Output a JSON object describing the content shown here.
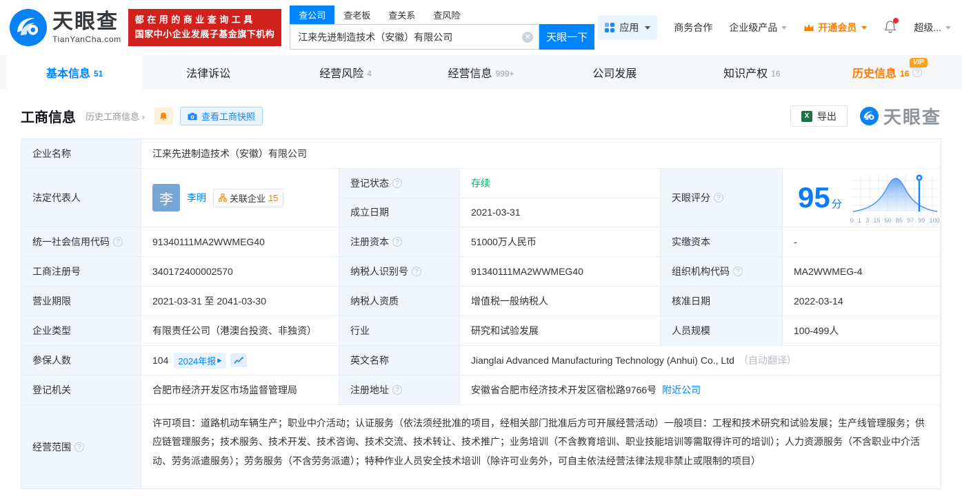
{
  "header": {
    "logo_name": "天眼查",
    "logo_domain": "TianYanCha.com",
    "banner_line1": "都在用的商业查询工具",
    "banner_line2": "国家中小企业发展子基金旗下机构",
    "search_tabs": [
      {
        "label": "查公司"
      },
      {
        "label": "查老板"
      },
      {
        "label": "查关系"
      },
      {
        "label": "查风险"
      }
    ],
    "search_value": "江来先进制造技术（安徽）有限公司",
    "search_button": "天眼一下",
    "nav_apps": "应用",
    "nav_cooperation": "商务合作",
    "nav_enterprise": "企业级产品",
    "nav_vip": "开通会员",
    "nav_user": "超级..."
  },
  "tabs": [
    {
      "label": "基本信息",
      "count": "51"
    },
    {
      "label": "法律诉讼",
      "count": ""
    },
    {
      "label": "经营风险",
      "count": "4"
    },
    {
      "label": "经营信息",
      "count": "999+"
    },
    {
      "label": "公司发展",
      "count": ""
    },
    {
      "label": "知识产权",
      "count": "16"
    },
    {
      "label": "历史信息",
      "count": "16",
      "badge": "VIP"
    }
  ],
  "toolbar": {
    "title": "工商信息",
    "history_link": "历史工商信息",
    "snapshot_button": "查看工商快照",
    "export_button": "导出",
    "excel_glyph": "X",
    "watermark": "天眼查"
  },
  "info": {
    "company_name_label": "企业名称",
    "company_name": "江来先进制造技术（安徽）有限公司",
    "legal_rep_label": "法定代表人",
    "legal_rep_avatar": "李",
    "legal_rep_name": "李明",
    "related_companies_label": "关联企业",
    "related_companies_count": "15",
    "reg_status_label": "登记状态",
    "reg_status": "存续",
    "establish_date_label": "成立日期",
    "establish_date": "2021-03-31",
    "credit_code_label": "统一社会信用代码",
    "credit_code": "91340111MA2WWMEG40",
    "reg_capital_label": "注册资本",
    "reg_capital": "51000万人民币",
    "paid_capital_label": "实缴资本",
    "paid_capital": "-",
    "reg_number_label": "工商注册号",
    "reg_number": "340172400002570",
    "taxpayer_id_label": "纳税人识别号",
    "taxpayer_id": "91340111MA2WWMEG40",
    "org_code_label": "组织机构代码",
    "org_code": "MA2WWMEG-4",
    "business_term_label": "营业期限",
    "business_term": "2021-03-31 至 2041-03-30",
    "taxpayer_quality_label": "纳税人资质",
    "taxpayer_quality": "增值税一般纳税人",
    "approval_date_label": "核准日期",
    "approval_date": "2022-03-14",
    "company_type_label": "企业类型",
    "company_type": "有限责任公司（港澳台投资、非独资）",
    "industry_label": "行业",
    "industry": "研究和试验发展",
    "staff_size_label": "人员规模",
    "staff_size": "100-499人",
    "insured_label": "参保人数",
    "insured_count": "104",
    "annual_report": "2024年报",
    "english_name_label": "英文名称",
    "english_name": "Jianglai Advanced Manufacturing Technology (Anhui) Co., Ltd",
    "english_name_note": "（自动翻译）",
    "reg_authority_label": "登记机关",
    "reg_authority": "合肥市经济开发区市场监督管理局",
    "address_label": "注册地址",
    "address": "安徽省合肥市经济技术开发区宿松路9766号",
    "nearby_link": "附近公司",
    "business_scope_label": "经营范围",
    "business_scope": "许可项目：道路机动车辆生产；职业中介活动；认证服务（依法须经批准的项目，经相关部门批准后方可开展经营活动）一般项目：工程和技术研究和试验发展；生产线管理服务；供应链管理服务；技术服务、技术开发、技术咨询、技术交流、技术转让、技术推广；业务培训（不含教育培训、职业技能培训等需取得许可的培训）；人力资源服务（不含职业中介活动、劳务派遣服务）；劳务服务（不含劳务派遣）；特种作业人员安全技术培训（除许可业务外，可自主依法经营法律法规非禁止或限制的项目）"
  },
  "score": {
    "label": "天眼评分",
    "value": "95",
    "unit": "分",
    "axis": [
      "0",
      "1",
      "3",
      "15",
      "50",
      "85",
      "97",
      "99",
      "100"
    ]
  },
  "colors": {
    "accent_blue": "#0084ff",
    "vip_orange": "#ff8000",
    "status_green": "#00b26a",
    "banner_red": "#d0211c",
    "label_cell_bg": "#f0f6fc"
  }
}
